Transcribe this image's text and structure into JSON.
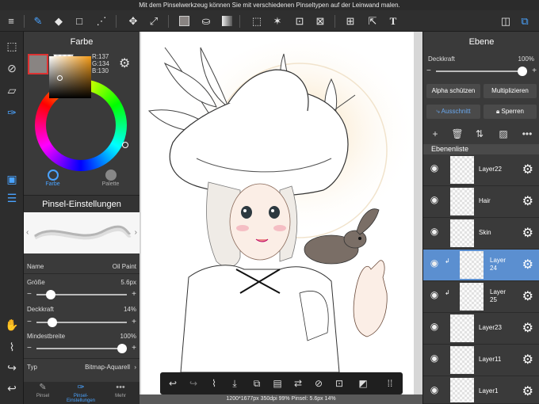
{
  "hint": "Mit dem Pinselwerkzeug können Sie mit verschiedenen Pinseltypen auf der Leinwand malen.",
  "color_panel": {
    "title": "Farbe",
    "rgb": {
      "r": "R:137",
      "g": "G:134",
      "b": "B:130"
    },
    "tabs": [
      {
        "label": "Farbe"
      },
      {
        "label": "Palette"
      }
    ],
    "main_color": "#898482"
  },
  "brush": {
    "title": "Pinsel-Einstellungen",
    "name_label": "Name",
    "name_value": "Oil Paint",
    "size_label": "Größe",
    "size_value": "5.6px",
    "size_level": 0.12,
    "opacity_label": "Deckkraft",
    "opacity_value": "14%",
    "opacity_level": 0.14,
    "minwidth_label": "Mindestbreite",
    "minwidth_value": "100%",
    "minwidth_level": 1.0,
    "type_label": "Typ",
    "type_value": "Bitmap-Aquarell"
  },
  "bottom_tabs": [
    {
      "label": "Pinsel"
    },
    {
      "label": "Pinsel-Einstellungen"
    },
    {
      "label": "Mehr"
    }
  ],
  "status": "1200*1677px 350dpi 99% Pinsel: 5.6px 14%",
  "layer_panel": {
    "title": "Ebene",
    "opacity_label": "Deckkraft",
    "opacity_value": "100%",
    "opacity_level": 1.0,
    "alpha_btn": "Alpha schützen",
    "blend_btn": "Multiplizieren",
    "clip_btn": "Ausschnitt",
    "lock_btn": "Sperren",
    "list_title": "Ebenenliste",
    "layers": [
      {
        "name": "Layer22",
        "selected": false
      },
      {
        "name": "Hair",
        "selected": false
      },
      {
        "name": "Skin",
        "selected": false
      },
      {
        "name": "Layer 24",
        "selected": true
      },
      {
        "name": "Layer 25",
        "selected": false
      },
      {
        "name": "Layer23",
        "selected": false
      },
      {
        "name": "Layer11",
        "selected": false
      },
      {
        "name": "Layer1",
        "selected": false
      }
    ]
  },
  "colors": {
    "accent": "#5b8fd0",
    "panel": "#3a3a3a",
    "toolbar": "#2f2f2f"
  }
}
